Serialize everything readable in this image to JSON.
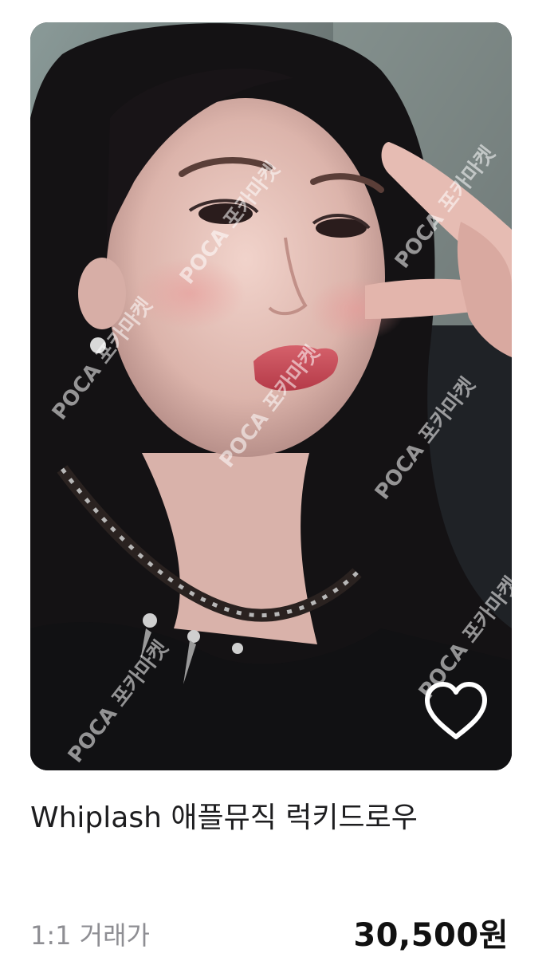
{
  "product": {
    "title": "Whiplash 애플뮤직 럭키드로우",
    "trade_label": "1:1 거래가",
    "price": "30,500원",
    "image": {
      "watermark_text": "POCA 포카마켓"
    },
    "wishlist_icon": "heart-outline-icon"
  },
  "colors": {
    "title": "#1d1d1f",
    "trade_label": "#8e8e93",
    "price": "#111111"
  }
}
